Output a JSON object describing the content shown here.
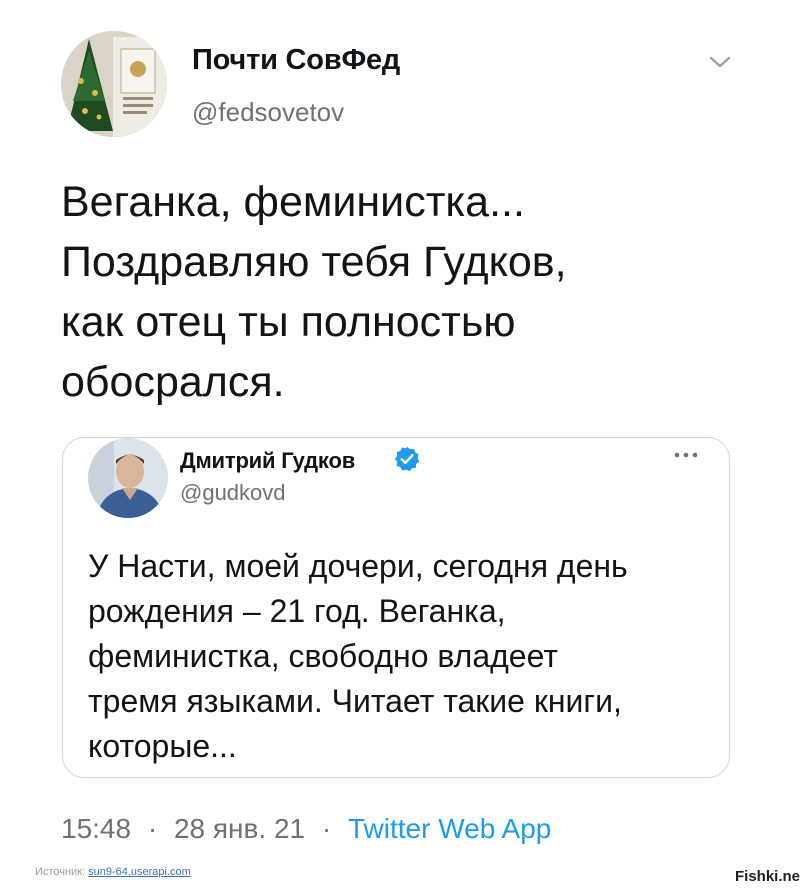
{
  "tweet": {
    "display_name": "Почти СовФед",
    "handle": "@fedsovetov",
    "avatar": "fedsovet-avatar",
    "menu_icon": "chevron-down-icon",
    "text": "Веганка, феминистка...\nПоздравляю тебя Гудков,\nкак отец ты полностью\nобосрался.",
    "time": "15:48",
    "date": "28 янв. 21",
    "separator": "·",
    "app": "Twitter Web App"
  },
  "quoted_tweet": {
    "display_name": "Дмитрий Гудков",
    "verified_icon": "verified-badge-icon",
    "handle": "@gudkovd",
    "more_icon": "more-dots-icon",
    "text": "У Насти, моей дочери, сегодня день\nрождения – 21 год. Веганка,\nфеминистка, свободно владеет\nтремя языками. Читает такие книги,\nкоторые..."
  },
  "source": {
    "label": "Источник:",
    "url": "sun9-64.userapi.com"
  },
  "watermark": "Fishki.net",
  "colors": {
    "link": "#1d9bf0",
    "secondary_text": "#6b7278",
    "border": "#d3d8dc"
  }
}
